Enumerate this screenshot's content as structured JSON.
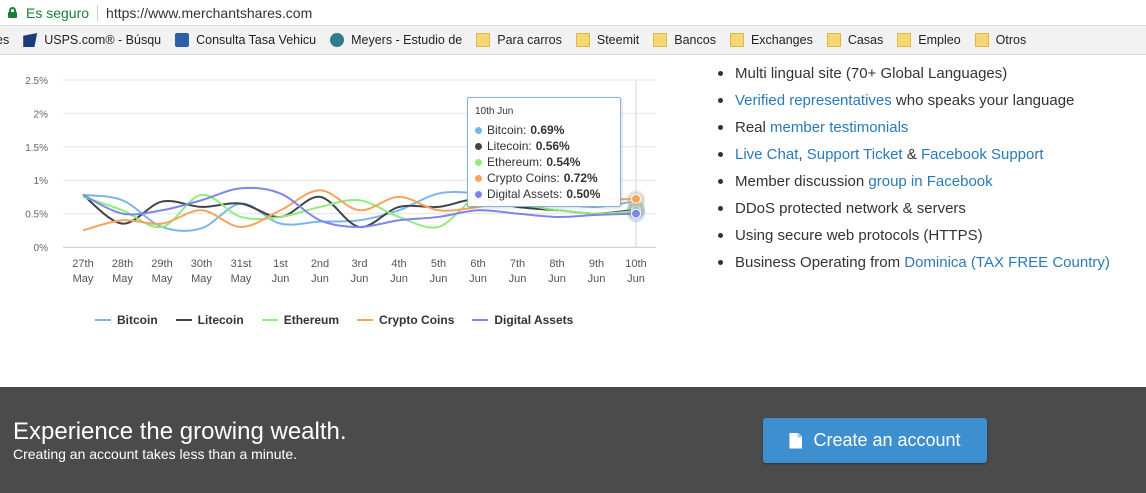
{
  "addressbar": {
    "secure_label": "Es seguro",
    "url": "https://www.merchantshares.com"
  },
  "bookmarks": [
    {
      "label": "es",
      "icon": "none"
    },
    {
      "label": "USPS.com® - Búsqu",
      "icon": "usps-icon"
    },
    {
      "label": "Consulta Tasa Vehicu",
      "icon": "document-icon"
    },
    {
      "label": "Meyers - Estudio de",
      "icon": "globe-icon"
    },
    {
      "label": "Para carros",
      "icon": "folder-icon"
    },
    {
      "label": "Steemit",
      "icon": "folder-icon"
    },
    {
      "label": "Bancos",
      "icon": "folder-icon"
    },
    {
      "label": "Exchanges",
      "icon": "folder-icon"
    },
    {
      "label": "Casas",
      "icon": "folder-icon"
    },
    {
      "label": "Empleo",
      "icon": "folder-icon"
    },
    {
      "label": "Otros",
      "icon": "folder-icon"
    }
  ],
  "chart_data": {
    "type": "line",
    "ylim": [
      0,
      2.5
    ],
    "yticks": [
      "0%",
      "0.5%",
      "1%",
      "1.5%",
      "2%",
      "2.5%"
    ],
    "categories": [
      "27th May",
      "28th May",
      "29th May",
      "30th May",
      "31st May",
      "1st Jun",
      "2nd Jun",
      "3rd Jun",
      "4th Jun",
      "5th Jun",
      "6th Jun",
      "7th Jun",
      "8th Jun",
      "9th Jun",
      "10th Jun"
    ],
    "series": [
      {
        "name": "Bitcoin",
        "color": "#7cb5ec",
        "values": [
          0.78,
          0.7,
          0.3,
          0.28,
          0.65,
          0.35,
          0.38,
          0.4,
          0.55,
          0.8,
          0.8,
          0.7,
          0.65,
          0.6,
          0.69
        ]
      },
      {
        "name": "Litecoin",
        "color": "#434348",
        "values": [
          0.78,
          0.35,
          0.68,
          0.6,
          0.65,
          0.45,
          0.75,
          0.3,
          0.6,
          0.6,
          0.72,
          0.6,
          0.55,
          0.5,
          0.56
        ]
      },
      {
        "name": "Ethereum",
        "color": "#90ed7d",
        "values": [
          0.75,
          0.55,
          0.3,
          0.78,
          0.45,
          0.45,
          0.6,
          0.7,
          0.45,
          0.3,
          0.75,
          0.65,
          0.55,
          0.5,
          0.54
        ]
      },
      {
        "name": "Crypto Coins",
        "color": "#f7a35c",
        "values": [
          0.25,
          0.4,
          0.35,
          0.55,
          0.3,
          0.55,
          0.85,
          0.55,
          0.75,
          0.55,
          0.6,
          0.7,
          0.65,
          0.7,
          0.72
        ]
      },
      {
        "name": "Digital Assets",
        "color": "#8085e9",
        "values": [
          0.78,
          0.5,
          0.55,
          0.7,
          0.88,
          0.8,
          0.4,
          0.3,
          0.4,
          0.45,
          0.55,
          0.5,
          0.45,
          0.48,
          0.5
        ]
      }
    ],
    "legend": "bottom-center",
    "grid": true
  },
  "tooltip": {
    "title": "10th Jun",
    "rows": [
      {
        "name": "Bitcoin:",
        "value": "0.69%",
        "color": "#7cb5ec"
      },
      {
        "name": "Litecoin:",
        "value": "0.56%",
        "color": "#434348"
      },
      {
        "name": "Ethereum:",
        "value": "0.54%",
        "color": "#90ed7d"
      },
      {
        "name": "Crypto Coins:",
        "value": "0.72%",
        "color": "#f7a35c"
      },
      {
        "name": "Digital Assets:",
        "value": "0.50%",
        "color": "#8085e9"
      }
    ]
  },
  "features": [
    {
      "parts": [
        {
          "text": "Multi lingual site (70+ Global Languages)",
          "link": false
        }
      ]
    },
    {
      "parts": [
        {
          "text": "Verified representatives",
          "link": true
        },
        {
          "text": " who speaks your language",
          "link": false
        }
      ]
    },
    {
      "parts": [
        {
          "text": "Real ",
          "link": false
        },
        {
          "text": "member testimonials",
          "link": true
        }
      ]
    },
    {
      "parts": [
        {
          "text": "Live Chat",
          "link": true
        },
        {
          "text": ", ",
          "link": false
        },
        {
          "text": "Support Ticket",
          "link": true
        },
        {
          "text": " & ",
          "link": false
        },
        {
          "text": "Facebook Support",
          "link": true
        }
      ]
    },
    {
      "parts": [
        {
          "text": "Member discussion ",
          "link": false
        },
        {
          "text": "group in Facebook",
          "link": true
        }
      ]
    },
    {
      "parts": [
        {
          "text": "DDoS protected network & servers",
          "link": false
        }
      ]
    },
    {
      "parts": [
        {
          "text": "Using secure web protocols (HTTPS)",
          "link": false
        }
      ]
    },
    {
      "parts": [
        {
          "text": "Business Operating from ",
          "link": false
        },
        {
          "text": "Dominica (TAX FREE Country)",
          "link": true
        }
      ]
    }
  ],
  "cta": {
    "title": "Experience the growing wealth.",
    "subtitle": "Creating an account takes less than a minute.",
    "button_label": "Create an account",
    "button_icon": "file-icon",
    "button_color": "#3d8fd0"
  }
}
